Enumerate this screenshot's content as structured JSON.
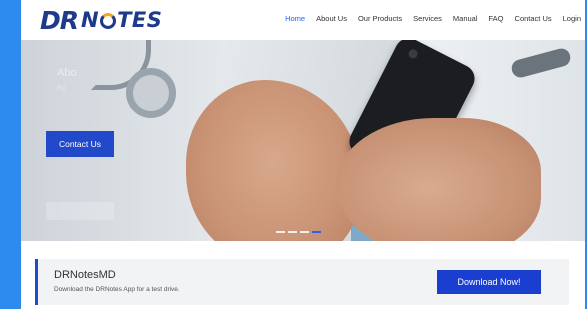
{
  "brand": {
    "logo_dr": "DR",
    "logo_notes_pre": "N",
    "logo_notes_post": "TES"
  },
  "nav": {
    "items": [
      {
        "label": "Home",
        "active": true
      },
      {
        "label": "About Us"
      },
      {
        "label": "Our Products"
      },
      {
        "label": "Services"
      },
      {
        "label": "Manual"
      },
      {
        "label": "FAQ"
      },
      {
        "label": "Contact Us"
      },
      {
        "label": "Login"
      }
    ]
  },
  "hero": {
    "overlay_title": "Abo",
    "overlay_sub": "Fo",
    "cta_label": "Contact Us",
    "slides": {
      "count": 4,
      "active_index": 3
    }
  },
  "promo": {
    "title": "DRNotesMD",
    "subtitle": "Download the DRNotes App for a test drive.",
    "button_label": "Download Now!"
  },
  "colors": {
    "page_background": "#2d8bf0",
    "accent": "#2249c9",
    "nav_active": "#2563eb",
    "logo": "#1e3a8a",
    "logo_highlight": "#f5a623"
  }
}
